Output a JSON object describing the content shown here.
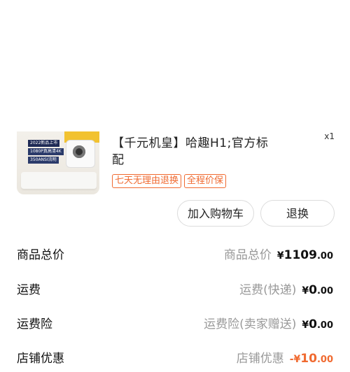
{
  "product": {
    "title": "【千元机皇】哈趣H1;官方标配",
    "quantity": "x1",
    "image_tags": [
      "2022新品上市",
      "1080P真高清4K",
      "350ANSI流明"
    ],
    "badges": [
      "七天无理由退换",
      "全程价保"
    ]
  },
  "actions": {
    "add_to_cart": "加入购物车",
    "return_exchange": "退换"
  },
  "summary": [
    {
      "label": "商品总价",
      "detail": "商品总价",
      "currency": "¥",
      "int": "1109",
      "dec": ".00",
      "negative": false
    },
    {
      "label": "运费",
      "detail": "运费(快递)",
      "currency": "¥",
      "int": "0",
      "dec": ".00",
      "negative": false
    },
    {
      "label": "运费险",
      "detail": "运费险(卖家赠送)",
      "currency": "¥",
      "int": "0",
      "dec": ".00",
      "negative": false
    },
    {
      "label": "店铺优惠",
      "detail": "店铺优惠",
      "currency": "-¥",
      "int": "10",
      "dec": ".00",
      "negative": true
    }
  ],
  "colors": {
    "accent": "#f06a30",
    "muted": "#999999"
  }
}
